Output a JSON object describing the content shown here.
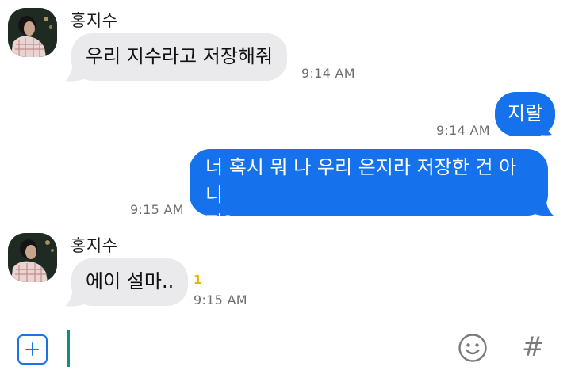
{
  "messages": [
    {
      "sender": "홍지수",
      "text": "우리 지수라고 저장해줘",
      "time": "9:14 AM",
      "direction": "incoming"
    },
    {
      "text": "지랄",
      "time": "9:14 AM",
      "direction": "outgoing"
    },
    {
      "text_line1": "너 혹시 뭐 나 우리 은지라 저장한 건 아니",
      "text_line2": "지?",
      "time": "9:15 AM",
      "direction": "outgoing"
    },
    {
      "sender": "홍지수",
      "text": "에이 설마..",
      "time": "9:15 AM",
      "unread": "1",
      "direction": "incoming"
    }
  ],
  "composer": {
    "attach_icon": "plus-square-icon",
    "emoji_icon": "smiley-icon",
    "hashtag": "#"
  },
  "colors": {
    "outgoing_bubble": "#1672ec",
    "incoming_bubble": "#eaeaed",
    "unread_count": "#e6b400",
    "cursor": "#0b8f84"
  }
}
